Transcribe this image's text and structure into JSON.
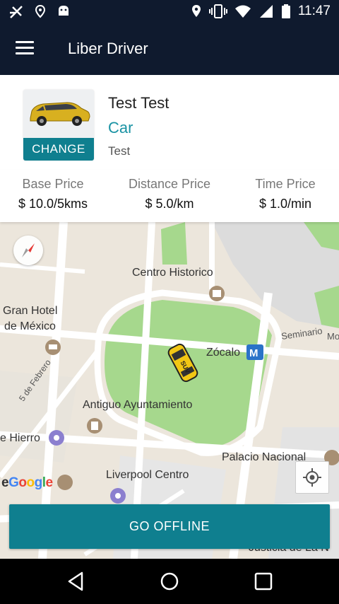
{
  "status_bar": {
    "time": "11:47",
    "left_icons": [
      "signal-off-icon",
      "location-pin-icon",
      "android-icon"
    ],
    "right_icons": [
      "location-icon",
      "vibrate-icon",
      "wifi-icon",
      "cellular-signal-icon",
      "battery-icon"
    ]
  },
  "app_bar": {
    "title": "Liber Driver",
    "menu_icon": "hamburger-menu-icon"
  },
  "vehicle": {
    "change_label": "CHANGE",
    "driver_name": "Test Test",
    "type": "Car",
    "note": "Test"
  },
  "prices": [
    {
      "label": "Base Price",
      "value": "$ 10.0/5kms"
    },
    {
      "label": "Distance Price",
      "value": "$ 5.0/km"
    },
    {
      "label": "Time Price",
      "value": "$ 1.0/min"
    }
  ],
  "map": {
    "labels": {
      "centro_historico": "Centro Historico",
      "gran_hotel_1": "Gran Hotel",
      "gran_hotel_2": "de México",
      "zocalo": "Zócalo",
      "seminario": "Seminario",
      "mo": "Mo",
      "cinco_de_febrero": "5 de Febrero",
      "antiguo_ayuntamiento": "Antiguo Ayuntamiento",
      "hierro": "e Hierro",
      "palacio_nacional": "Palacio Nacional",
      "liverpool_centro": "Liverpool Centro",
      "justicia": "Justicia de La N",
      "metro_badge": "M",
      "car_badge": "SUV"
    },
    "google_logo": {
      "prefix": "e",
      "letters": [
        "G",
        "o",
        "o",
        "g",
        "l",
        "e"
      ]
    },
    "go_offline_label": "GO OFFLINE"
  },
  "colors": {
    "app_bar": "#0f1a2e",
    "accent": "#0f7f8f",
    "vehicle_type_text": "#1a93a4",
    "park_green": "#a6d88d",
    "road_white": "#ffffff",
    "block_beige": "#ece6dc"
  },
  "nav_bar": {
    "icons": [
      "back-icon",
      "home-icon",
      "recents-icon"
    ]
  }
}
